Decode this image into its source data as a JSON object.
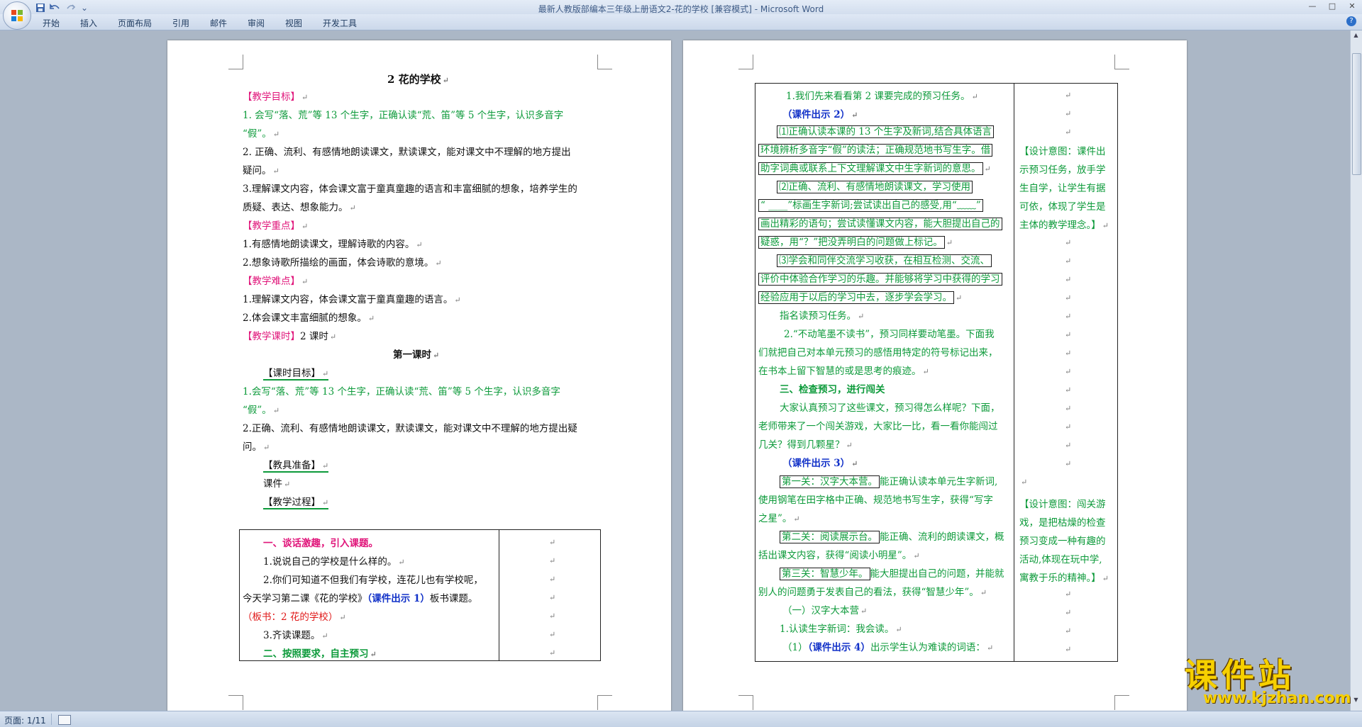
{
  "window": {
    "title": "最新人教版部编本三年级上册语文2-花的学校 [兼容模式]",
    "app_name": "Microsoft Word",
    "controls": [
      "—",
      "□",
      "✕"
    ]
  },
  "qat": {
    "dropdown": "⌄"
  },
  "menu": [
    "开始",
    "插入",
    "页面布局",
    "引用",
    "邮件",
    "审阅",
    "视图",
    "开发工具"
  ],
  "help": "?",
  "status": {
    "page": "页面: 1/11"
  },
  "mark": "↵",
  "left_page": {
    "title": "2 花的学校",
    "goal_heading": "【教学目标】",
    "goal1a": "1. 会写“落、荒”等 13 个生字，正确认读“荒、笛”等 5 个生字，认识多音字",
    "goal1b": "“假”。",
    "goal2a": "2. 正确、流利、有感情地朗读课文，默读课文，能对课文中不理解的地方提出",
    "goal2b": "疑问。",
    "goal3a": "3.理解课文内容，体会课文富于童真童趣的语言和丰富细腻的想象，培养学生的",
    "goal3b": "质疑、表达、想象能力。",
    "key_heading": "【教学重点】",
    "key1": "1.有感情地朗读课文，理解诗歌的内容。",
    "key2": "2.想象诗歌所描绘的画面，体会诗歌的意境。",
    "diff_heading": "【教学难点】",
    "diff1": "1.理解课文内容，体会课文富于童真童趣的语言。",
    "diff2": "2.体会课文丰富细腻的想象。",
    "hours_heading": "【教学课时】",
    "hours_value": "2 课时",
    "lesson_title": "第一课时",
    "lgoal_heading": "【课时目标】",
    "lgoal1a": "1.会写“落、荒”等 13 个生字，正确认读“荒、笛”等 5 个生字，认识多音字",
    "lgoal1b": "“假”。",
    "lgoal2a": "2.正确、流利、有感情地朗读课文，默读课文，能对课文中不理解的地方提出疑",
    "lgoal2b": "问。",
    "prep_heading": "【教具准备】",
    "prep_value": "课件",
    "process_heading": "【教学过程】",
    "table": {
      "r1": "一、谈话激趣，引入课题。",
      "r2": "1.说说自己的学校是什么样的。",
      "r3a": "2.你们可知道不但我们有学校，连花儿也有学校呢，",
      "r3b_pre": "今天学习第二课《花的学校》",
      "r3b_blue": "（课件出示 1）",
      "r3b_post": "板书课题。",
      "r4": "（板书：2 花的学校）",
      "r5": "3.齐读课题。",
      "r6": "二、按照要求，自主预习"
    }
  },
  "right_page": {
    "l1": "1.我们先来看看第 2 课要完成的预习任务。",
    "l2": "（课件出示 2）",
    "l3": "⑴正确认读本课的 13 个生字及新词,结合具体语言",
    "l4": "环境辨析多音字“假”的读法；正确规范地书写生字。借",
    "l5": "助字词典或联系上下文理解课文中生字新词的意思。",
    "l6": "⑵正确、流利、有感情地朗读课文，学习使用",
    "l7": "“ ____”标画生字新词;尝试读出自己的感受,用“﹏﹏”",
    "l8": "画出精彩的语句；尝试读懂课文内容，能大胆提出自己的",
    "l9": "疑惑，用“？”把没弄明白的问题做上标记。",
    "l10": "⑶学会和同伴交流学习收获，在相互检测、交流、",
    "l11": "评价中体验合作学习的乐趣。并能够将学习中获得的学习",
    "l12": "经验应用于以后的学习中去，逐步学会学习。",
    "l13": "指名读预习任务。",
    "l14": "2.“不动笔墨不读书”，预习同样要动笔墨。下面我",
    "l15": "们就把自己对本单元预习的感悟用特定的符号标记出来，",
    "l16": "在书本上留下智慧的或是思考的痕迹。",
    "l17": "三、检查预习，进行闯关",
    "l18": "大家认真预习了这些课文，预习得怎么样呢？下面，",
    "l19": "老师带来了一个闯关游戏，大家比一比，看一看你能闯过",
    "l20": "几关？得到几颗星？",
    "l21": "（课件出示 3）",
    "l22_box": "第一关：汉字大本营。",
    "l22_rest": "能正确认读本单元生字新词,",
    "l23": "使用钢笔在田字格中正确、规范地书写生字，获得“写字",
    "l24": "之星”。",
    "l25_box": "第二关：阅读展示台。",
    "l25_rest": "能正确、流利的朗读课文，概",
    "l26": "括出课文内容，获得“阅读小明星”。",
    "l27_box": "第三关：智慧少年。",
    "l27_rest": "能大胆提出自己的问题，并能就",
    "l28": "别人的问题勇于发表自己的看法，获得“智慧少年”。",
    "l29": "（一）汉字大本营",
    "l30": "1.认读生字新词：我会读。",
    "l31_pre": "（1）",
    "l31_blue": "（课件出示 4）",
    "l31_post": "出示学生认为难读的词语：",
    "side1": [
      "【设计意图：课件出",
      "示预习任务，放手学",
      "生自学，让学生有据",
      "可依，体现了学生是",
      "主体的教学理念。】"
    ],
    "side2": [
      "【设计意图：闯关游",
      "戏，是把枯燥的检查",
      "预习变成一种有趣的",
      "活动,体现在玩中学,",
      "寓教于乐的精神。】"
    ]
  },
  "watermark": {
    "title": "课件站",
    "url": "www.kjzhan.com"
  },
  "colors": {
    "magenta": "#e0157a",
    "green": "#0c9a3a",
    "blue": "#1030c8",
    "red": "#e01818"
  }
}
